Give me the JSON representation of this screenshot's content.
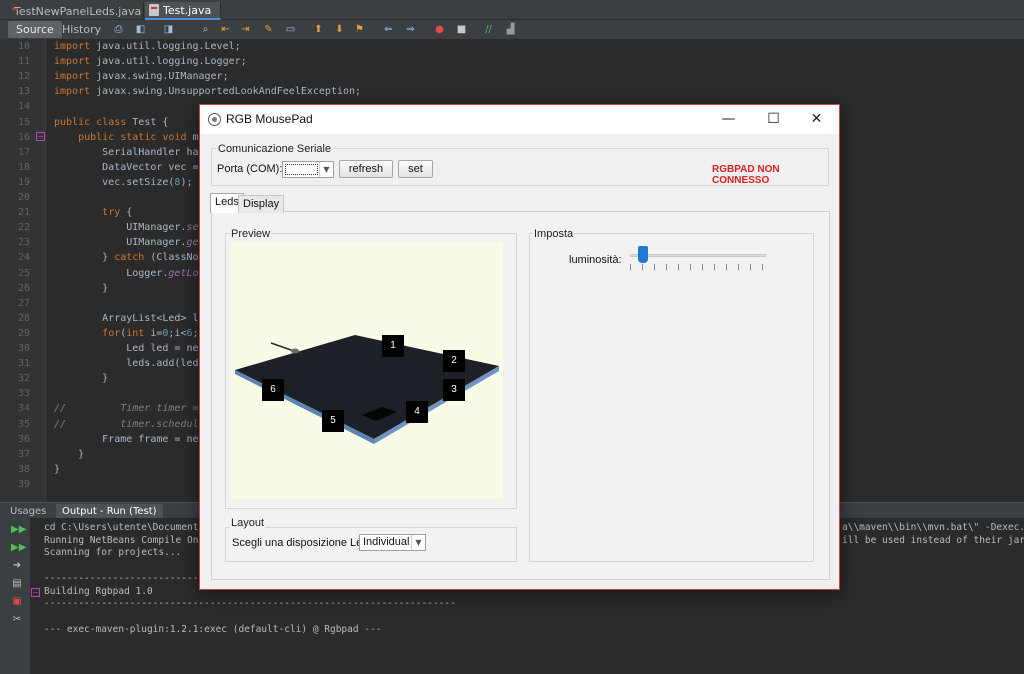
{
  "ide": {
    "editor_tabs": [
      {
        "label": "TestNewPanelLeds.java"
      },
      {
        "label": "Test.java"
      }
    ],
    "close_glyph": "✕",
    "toolbar": {
      "source_label": "Source",
      "history_label": "History",
      "icons": [
        "last-edit-icon",
        "back-icon",
        "forward-icon",
        "find-icon",
        "find-prev-icon",
        "find-next-icon",
        "toggle-highlight-icon",
        "toggle-select-icon",
        "prev-bookmark-icon",
        "next-bookmark-icon",
        "toggle-bookmark-icon",
        "shift-left-icon",
        "shift-right-icon",
        "start-macro-icon",
        "stop-macro-icon",
        "comment-icon",
        "uncomment-icon"
      ]
    },
    "code_lines": [
      {
        "n": "10",
        "text": "import java.util.logging.Level;"
      },
      {
        "n": "11",
        "text": "import java.util.logging.Logger;"
      },
      {
        "n": "12",
        "text": "import javax.swing.UIManager;"
      },
      {
        "n": "13",
        "text": "import javax.swing.UnsupportedLookAndFeelException;"
      },
      {
        "n": "14",
        "text": ""
      },
      {
        "n": "15",
        "text": "public class Test {"
      },
      {
        "n": "16",
        "text": "    public static void m"
      },
      {
        "n": "17",
        "text": "        SerialHandler ha"
      },
      {
        "n": "18",
        "text": "        DataVector vec ="
      },
      {
        "n": "19",
        "text": "        vec.setSize(8);"
      },
      {
        "n": "20",
        "text": ""
      },
      {
        "n": "21",
        "text": "        try {"
      },
      {
        "n": "22",
        "text": "            UIManager.se"
      },
      {
        "n": "23",
        "text": "            UIManager.ge"
      },
      {
        "n": "24",
        "text": "        } catch (ClassNo"
      },
      {
        "n": "25",
        "text": "            Logger.getLo"
      },
      {
        "n": "26",
        "text": "        }"
      },
      {
        "n": "27",
        "text": ""
      },
      {
        "n": "28",
        "text": "        ArrayList<Led> l"
      },
      {
        "n": "29",
        "text": "        for(int i=0;i<6;"
      },
      {
        "n": "30",
        "text": "            Led led = ne"
      },
      {
        "n": "31",
        "text": "            leds.add(led"
      },
      {
        "n": "32",
        "text": "        }"
      },
      {
        "n": "33",
        "text": ""
      },
      {
        "n": "34",
        "text": "//         Timer timer ="
      },
      {
        "n": "35",
        "text": "//         timer.schedule"
      },
      {
        "n": "36",
        "text": "        Frame frame = ne"
      },
      {
        "n": "37",
        "text": "    }"
      },
      {
        "n": "38",
        "text": "}"
      },
      {
        "n": "39",
        "text": ""
      }
    ],
    "bottom_tabs": [
      {
        "label": "Usages"
      },
      {
        "label": "Output - Run (Test)"
      }
    ],
    "output_lines": [
      "cd C:\\Users\\utente\\Documents\\N",
      "Running NetBeans Compile On Sa",
      "Scanning for projects...",
      "",
      "------------------------------------------------------------------------",
      "Building Rgbpad 1.0",
      "------------------------------------------------------------------------",
      "",
      "--- exec-maven-plugin:1.2.1:exec (default-cli) @ Rgbpad ---"
    ],
    "output_right": [
      "a\\\\maven\\\\bin\\\\mvn.bat\\\" -Dexec.arg",
      "ill be used instead of their jar ar"
    ],
    "fold_glyph": "−"
  },
  "dialog": {
    "title": "RGB MousePad",
    "minimize_glyph": "—",
    "maximize_glyph": "☐",
    "close_glyph": "✕",
    "serial": {
      "group_label": "Comunicazione Seriale",
      "port_label": "Porta (COM):",
      "port_value": "",
      "refresh_label": "refresh",
      "set_label": "set",
      "status_text": "RGBPAD NON CONNESSO",
      "status_color": "#e02020"
    },
    "tabs": [
      {
        "label": "Leds"
      },
      {
        "label": "Display"
      }
    ],
    "preview": {
      "group_label": "Preview",
      "leds": [
        "1",
        "2",
        "3",
        "4",
        "5",
        "6"
      ]
    },
    "layout": {
      "group_label": "Layout",
      "select_label": "Scegli una disposizione Led:",
      "select_value": "Individual"
    },
    "settings": {
      "group_label": "Imposta",
      "brightness_label": "luminosità:",
      "brightness_level": 0.1
    },
    "dropdown_glyph": "▼"
  }
}
